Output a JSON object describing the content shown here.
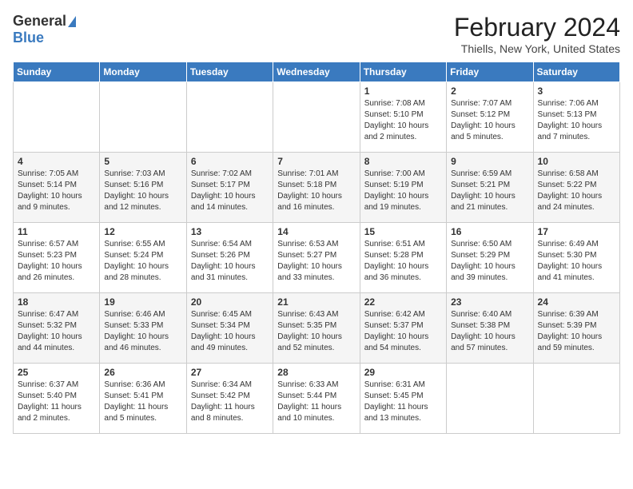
{
  "header": {
    "logo_general": "General",
    "logo_blue": "Blue",
    "month_title": "February 2024",
    "location": "Thiells, New York, United States"
  },
  "calendar": {
    "days_of_week": [
      "Sunday",
      "Monday",
      "Tuesday",
      "Wednesday",
      "Thursday",
      "Friday",
      "Saturday"
    ],
    "weeks": [
      [
        {
          "day": "",
          "content": ""
        },
        {
          "day": "",
          "content": ""
        },
        {
          "day": "",
          "content": ""
        },
        {
          "day": "",
          "content": ""
        },
        {
          "day": "1",
          "content": "Sunrise: 7:08 AM\nSunset: 5:10 PM\nDaylight: 10 hours\nand 2 minutes."
        },
        {
          "day": "2",
          "content": "Sunrise: 7:07 AM\nSunset: 5:12 PM\nDaylight: 10 hours\nand 5 minutes."
        },
        {
          "day": "3",
          "content": "Sunrise: 7:06 AM\nSunset: 5:13 PM\nDaylight: 10 hours\nand 7 minutes."
        }
      ],
      [
        {
          "day": "4",
          "content": "Sunrise: 7:05 AM\nSunset: 5:14 PM\nDaylight: 10 hours\nand 9 minutes."
        },
        {
          "day": "5",
          "content": "Sunrise: 7:03 AM\nSunset: 5:16 PM\nDaylight: 10 hours\nand 12 minutes."
        },
        {
          "day": "6",
          "content": "Sunrise: 7:02 AM\nSunset: 5:17 PM\nDaylight: 10 hours\nand 14 minutes."
        },
        {
          "day": "7",
          "content": "Sunrise: 7:01 AM\nSunset: 5:18 PM\nDaylight: 10 hours\nand 16 minutes."
        },
        {
          "day": "8",
          "content": "Sunrise: 7:00 AM\nSunset: 5:19 PM\nDaylight: 10 hours\nand 19 minutes."
        },
        {
          "day": "9",
          "content": "Sunrise: 6:59 AM\nSunset: 5:21 PM\nDaylight: 10 hours\nand 21 minutes."
        },
        {
          "day": "10",
          "content": "Sunrise: 6:58 AM\nSunset: 5:22 PM\nDaylight: 10 hours\nand 24 minutes."
        }
      ],
      [
        {
          "day": "11",
          "content": "Sunrise: 6:57 AM\nSunset: 5:23 PM\nDaylight: 10 hours\nand 26 minutes."
        },
        {
          "day": "12",
          "content": "Sunrise: 6:55 AM\nSunset: 5:24 PM\nDaylight: 10 hours\nand 28 minutes."
        },
        {
          "day": "13",
          "content": "Sunrise: 6:54 AM\nSunset: 5:26 PM\nDaylight: 10 hours\nand 31 minutes."
        },
        {
          "day": "14",
          "content": "Sunrise: 6:53 AM\nSunset: 5:27 PM\nDaylight: 10 hours\nand 33 minutes."
        },
        {
          "day": "15",
          "content": "Sunrise: 6:51 AM\nSunset: 5:28 PM\nDaylight: 10 hours\nand 36 minutes."
        },
        {
          "day": "16",
          "content": "Sunrise: 6:50 AM\nSunset: 5:29 PM\nDaylight: 10 hours\nand 39 minutes."
        },
        {
          "day": "17",
          "content": "Sunrise: 6:49 AM\nSunset: 5:30 PM\nDaylight: 10 hours\nand 41 minutes."
        }
      ],
      [
        {
          "day": "18",
          "content": "Sunrise: 6:47 AM\nSunset: 5:32 PM\nDaylight: 10 hours\nand 44 minutes."
        },
        {
          "day": "19",
          "content": "Sunrise: 6:46 AM\nSunset: 5:33 PM\nDaylight: 10 hours\nand 46 minutes."
        },
        {
          "day": "20",
          "content": "Sunrise: 6:45 AM\nSunset: 5:34 PM\nDaylight: 10 hours\nand 49 minutes."
        },
        {
          "day": "21",
          "content": "Sunrise: 6:43 AM\nSunset: 5:35 PM\nDaylight: 10 hours\nand 52 minutes."
        },
        {
          "day": "22",
          "content": "Sunrise: 6:42 AM\nSunset: 5:37 PM\nDaylight: 10 hours\nand 54 minutes."
        },
        {
          "day": "23",
          "content": "Sunrise: 6:40 AM\nSunset: 5:38 PM\nDaylight: 10 hours\nand 57 minutes."
        },
        {
          "day": "24",
          "content": "Sunrise: 6:39 AM\nSunset: 5:39 PM\nDaylight: 10 hours\nand 59 minutes."
        }
      ],
      [
        {
          "day": "25",
          "content": "Sunrise: 6:37 AM\nSunset: 5:40 PM\nDaylight: 11 hours\nand 2 minutes."
        },
        {
          "day": "26",
          "content": "Sunrise: 6:36 AM\nSunset: 5:41 PM\nDaylight: 11 hours\nand 5 minutes."
        },
        {
          "day": "27",
          "content": "Sunrise: 6:34 AM\nSunset: 5:42 PM\nDaylight: 11 hours\nand 8 minutes."
        },
        {
          "day": "28",
          "content": "Sunrise: 6:33 AM\nSunset: 5:44 PM\nDaylight: 11 hours\nand 10 minutes."
        },
        {
          "day": "29",
          "content": "Sunrise: 6:31 AM\nSunset: 5:45 PM\nDaylight: 11 hours\nand 13 minutes."
        },
        {
          "day": "",
          "content": ""
        },
        {
          "day": "",
          "content": ""
        }
      ]
    ]
  }
}
